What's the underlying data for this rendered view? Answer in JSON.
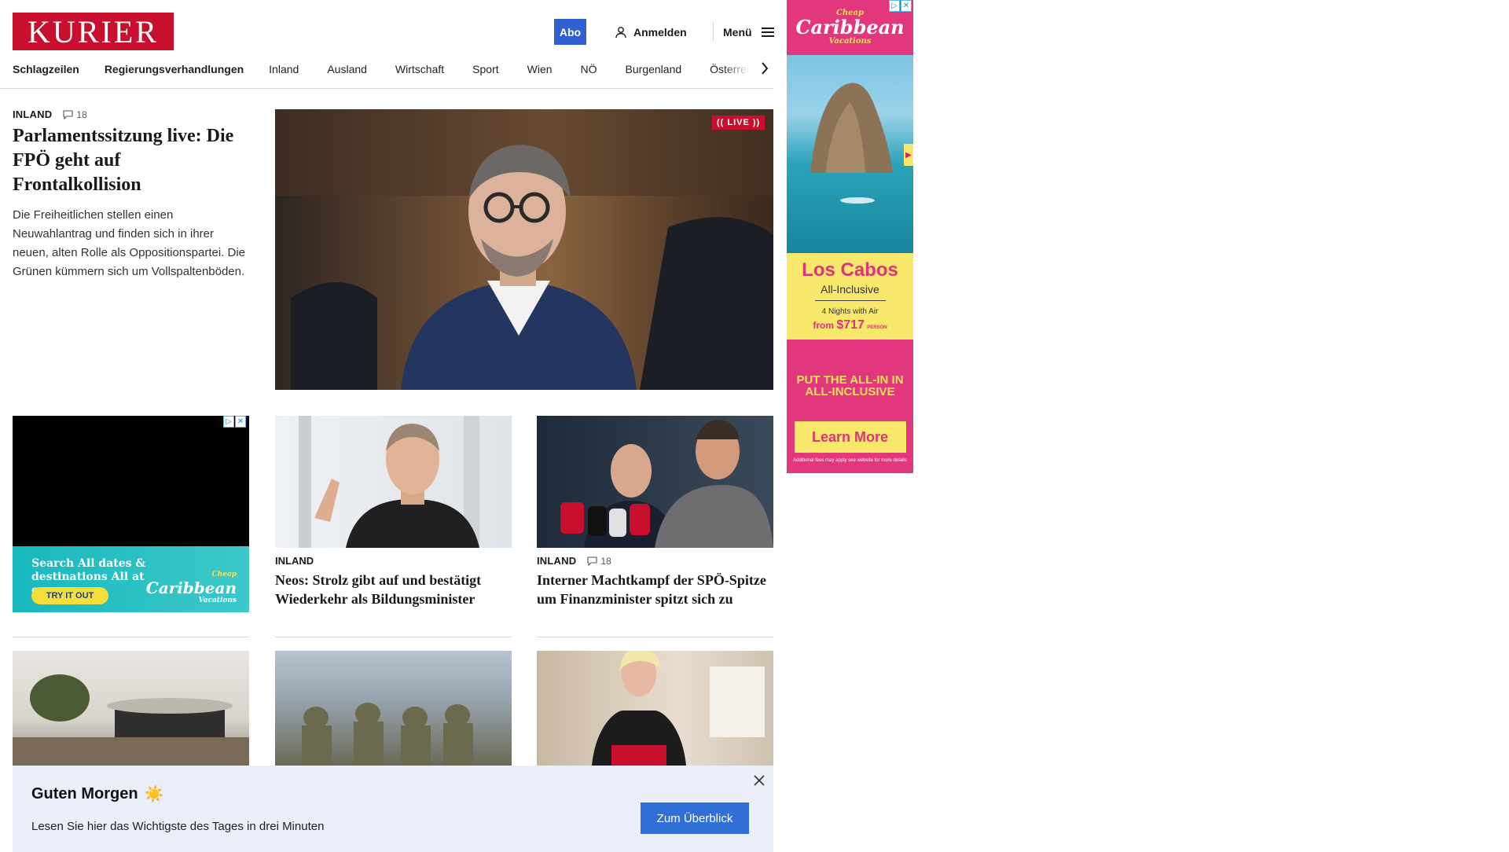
{
  "header": {
    "logo": "KURIER",
    "abo_label": "Abo",
    "login_label": "Anmelden",
    "menu_label": "Menü"
  },
  "nav": {
    "items": [
      "Schlagzeilen",
      "Regierungsverhandlungen",
      "Inland",
      "Ausland",
      "Wirtschaft",
      "Sport",
      "Wien",
      "NÖ",
      "Burgenland",
      "Österreich"
    ]
  },
  "lead": {
    "kicker": "INLAND",
    "comments": "18",
    "title": "Parlamentssitzung live: Die FPÖ geht auf Frontalkollision",
    "teaser": "Die Freiheitlichen stellen einen Neuwahlantrag und finden sich in ihrer neuen, alten Rolle als Oppositionspartei. Die Grünen kümmern sich um Vollspaltenböden.",
    "live_badge": "(( LIVE ))"
  },
  "cards": [
    {
      "kicker": "INLAND",
      "comments": "",
      "title": "Neos: Strolz gibt auf und bestätigt Wiederkehr als Bildungsminister"
    },
    {
      "kicker": "INLAND",
      "comments": "18",
      "title": "Interner Machtkampf der SPÖ-Spitze um Finanzminister spitzt sich zu"
    }
  ],
  "ad_left": {
    "text": "Search All dates & destinations All at once",
    "cta": "TRY IT OUT",
    "brand": "Caribbean",
    "brand_small": "Cheap",
    "brand_sub": "Vacations"
  },
  "ad_sky": {
    "brand_small": "Cheap",
    "brand": "Caribbean",
    "brand_sub": "Vacations",
    "destination": "Los Cabos",
    "package": "All-Inclusive",
    "nights": "4 Nights with Air",
    "price_prefix": "from",
    "price": "$717",
    "price_suffix": "PERSON",
    "slogan": "PUT THE ALL-IN IN ALL-INCLUSIVE",
    "cta": "Learn More",
    "fine_print": "Additional fees may apply see website for more details"
  },
  "banner": {
    "title": "Guten Morgen",
    "emoji": "☀️",
    "subtitle": "Lesen Sie hier das Wichtigste des Tages in drei Minuten",
    "button": "Zum Überblick"
  },
  "colors": {
    "brand_red": "#c8102e",
    "abo_blue": "#2f5fd0",
    "ad_pink": "#e2377c",
    "ad_yellow": "#f7e76a"
  }
}
